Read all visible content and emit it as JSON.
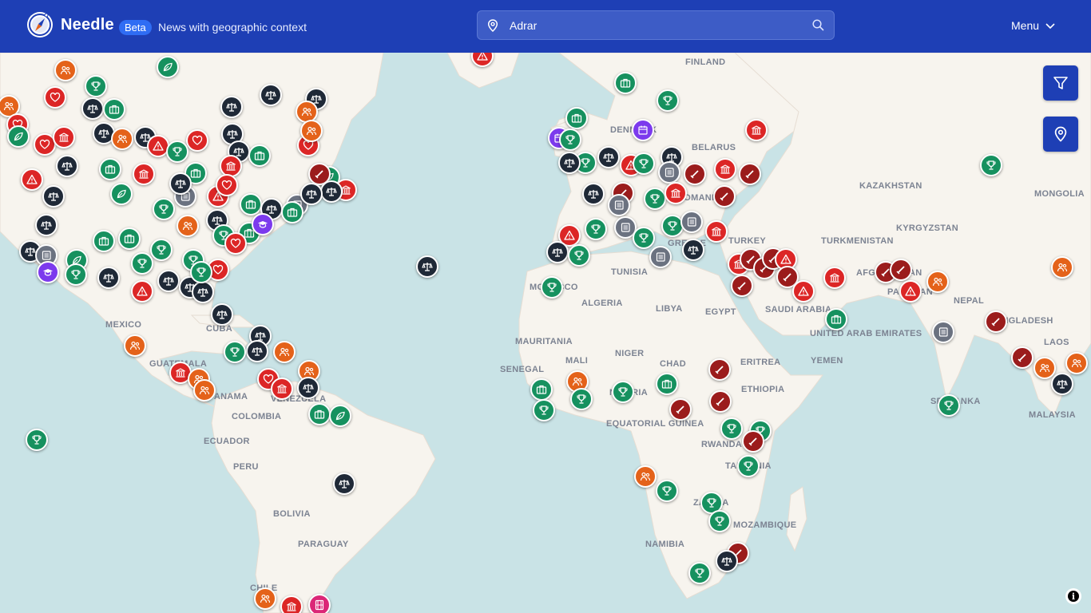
{
  "header": {
    "brand": "Needle",
    "badge": "Beta",
    "tagline": "News with geographic context",
    "search_value": "Adrar",
    "menu_label": "Menu"
  },
  "colors": {
    "header_bg": "#1e3fb5",
    "water": "#c9e3e6",
    "land": "#f7f4ee",
    "dark_slate": "#1f2937",
    "green": "#16915f",
    "red": "#dc2626",
    "dark_red": "#9b1c1c",
    "orange": "#e4621a",
    "purple": "#7c3aed",
    "gray": "#6b7280",
    "pink": "#db2777"
  },
  "map": {
    "country_labels": [
      "FINLAND",
      "DENMARK",
      "BELARUS",
      "KAZAKHSTAN",
      "MONGOLIA",
      "KYRGYZSTAN",
      "TURKMENISTAN",
      "TURKEY",
      "TUNISIA",
      "ALGERIA",
      "LIBYA",
      "EGYPT",
      "MOROCCO",
      "AFGHANISTAN",
      "PAKISTAN",
      "NEPAL",
      "BANGLADESH",
      "SAUDI ARABIA",
      "UNITED ARAB EMIRATES",
      "YEMEN",
      "ERITREA",
      "ETHIOPIA",
      "MAURITANIA",
      "MALI",
      "NIGER",
      "CHAD",
      "SENEGAL",
      "NIGERIA",
      "EQUATORIAL GUINEA",
      "RWANDA",
      "TANZANIA",
      "ZAMBIA",
      "MOZAMBIQUE",
      "NAMIBIA",
      "SRI LANKA",
      "MALAYSIA",
      "LAOS",
      "MEXICO",
      "CUBA",
      "GUATEMALA",
      "PANAMA",
      "VENEZUELA",
      "COLOMBIA",
      "ECUADOR",
      "PERU",
      "BOLIVIA",
      "PARAGUAY",
      "CHILE",
      "ROMANIA",
      "GREECE"
    ],
    "marker_categories": [
      "justice",
      "award",
      "business",
      "conflict",
      "alert",
      "government",
      "health",
      "people",
      "environment",
      "education",
      "news",
      "event",
      "media"
    ]
  },
  "controls": {
    "filter": "filter-icon",
    "locate": "location-pin-icon",
    "info": "i"
  }
}
